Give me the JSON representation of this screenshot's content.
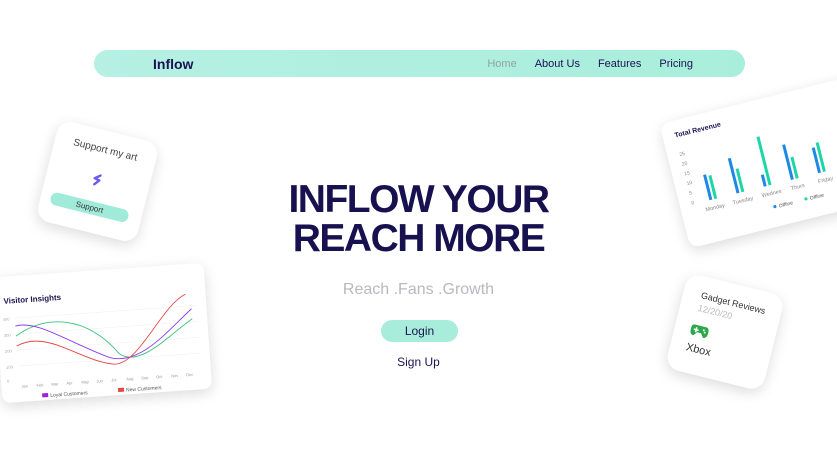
{
  "nav": {
    "brand": "Inflow",
    "links": [
      "Home",
      "About Us",
      "Features",
      "Pricing"
    ]
  },
  "hero": {
    "title_line1": "INFLOW YOUR",
    "title_line2": "REACH MORE",
    "subtitle": "Reach .Fans .Growth",
    "login": "Login",
    "signup": "Sign Up"
  },
  "support_card": {
    "title": "Support my art",
    "button": "Support"
  },
  "revenue_card": {
    "title": "Total Revenue",
    "days": [
      "Monday",
      "Tuesday",
      "Wednes",
      "Thurs",
      "Friday"
    ],
    "legend": [
      "Offline",
      "Offline"
    ],
    "y_ticks": [
      "25",
      "20",
      "15",
      "10",
      "5",
      "0"
    ]
  },
  "visitor_card": {
    "title": "Visitor Insights",
    "months": [
      "Jan",
      "Feb",
      "Mar",
      "Apr",
      "May",
      "Jun",
      "Jul",
      "Aug",
      "Sep",
      "Oct",
      "Nov",
      "Dec"
    ],
    "y_ticks": [
      "400",
      "300",
      "200",
      "100",
      "0"
    ],
    "legend": [
      "Loyal Customers",
      "New Customers"
    ]
  },
  "gadget_card": {
    "title": "Gadget Reviews",
    "date": "12/20/20",
    "name": "Xbox"
  },
  "colors": {
    "navy": "#17114f",
    "mint": "#a8ecdc",
    "teal_bar": "#1ed6a5",
    "blue_bar": "#1e88e5"
  }
}
